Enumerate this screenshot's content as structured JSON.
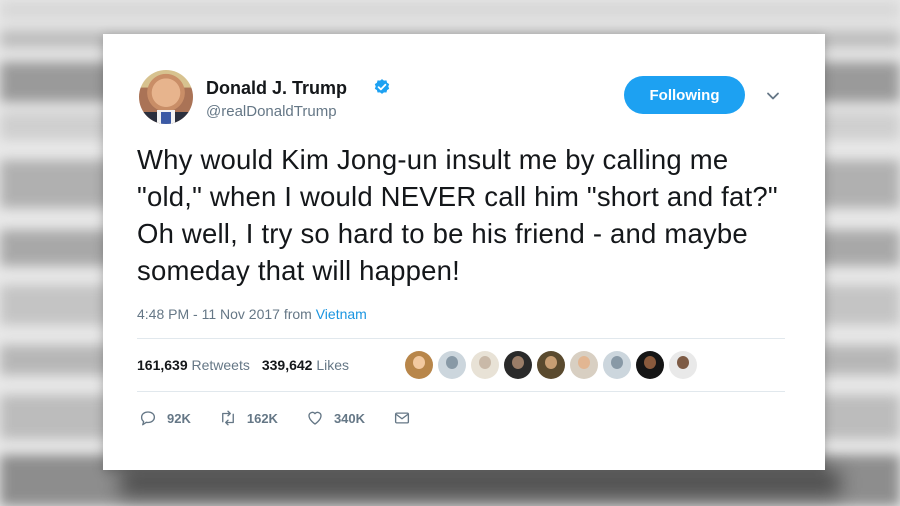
{
  "user": {
    "name": "Donald J. Trump",
    "handle": "@realDonaldTrump"
  },
  "follow_button": {
    "label": "Following"
  },
  "tweet": {
    "text": "Why would Kim Jong-un insult me by calling me \"old,\" when I would NEVER call him \"short and fat?\" Oh well, I try so hard to be his friend - and maybe someday that will happen!",
    "time": "4:48 PM - 11 Nov 2017",
    "from_label": "from",
    "location": "Vietnam"
  },
  "stats": {
    "retweets_count": "161,639",
    "retweets_label": "Retweets",
    "likes_count": "339,642",
    "likes_label": "Likes"
  },
  "actions": {
    "replies": "92K",
    "retweets": "162K",
    "likes": "340K"
  },
  "icons": {
    "reply": "reply-icon",
    "retweet": "retweet-icon",
    "like": "heart-icon",
    "dm": "envelope-icon",
    "verified": "verified-badge-icon",
    "more": "chevron-down-icon"
  },
  "colors": {
    "accent": "#1da1f2",
    "link": "#1b95e0",
    "text": "#14171a",
    "muted": "#657786"
  }
}
